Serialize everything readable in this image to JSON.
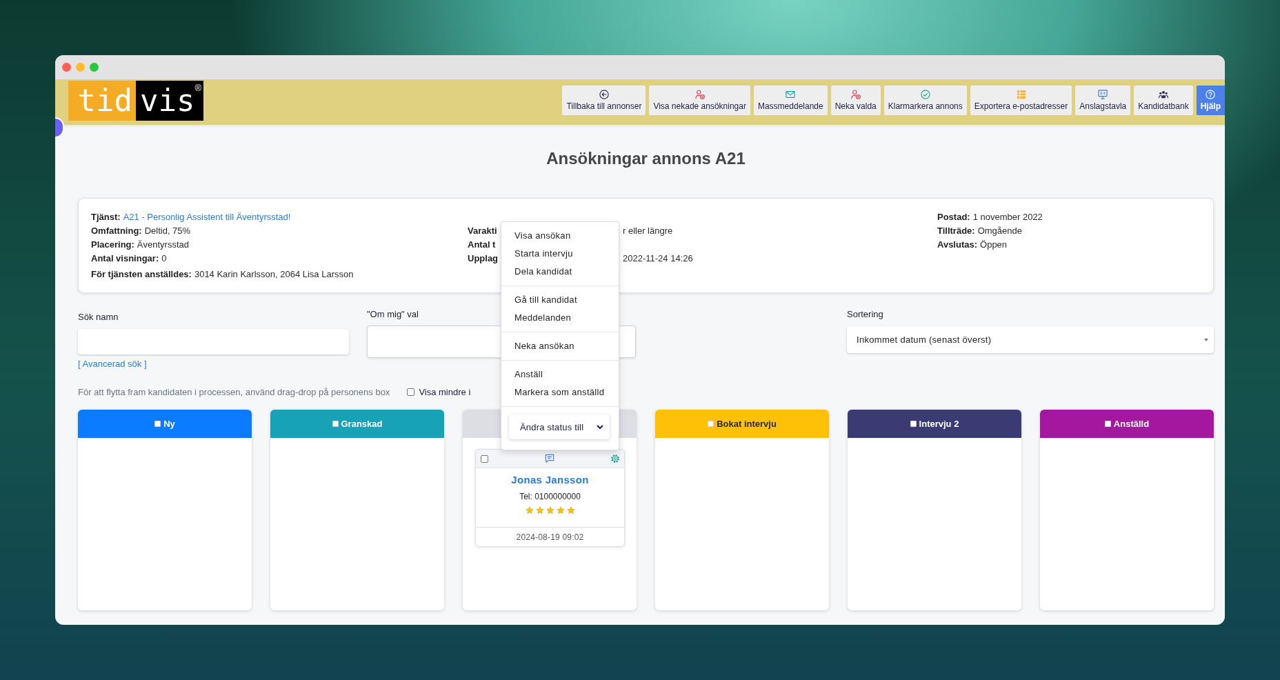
{
  "logo": {
    "left": "tid",
    "right": "vis",
    "mark": "®"
  },
  "toolbar": [
    {
      "label": "Tillbaka till annonser",
      "kind": "default"
    },
    {
      "label": "Visa nekade ansökningar",
      "kind": "default"
    },
    {
      "label": "Massmeddelande",
      "kind": "default"
    },
    {
      "label": "Neka valda",
      "kind": "default"
    },
    {
      "label": "Klarmarkera annons",
      "kind": "default"
    },
    {
      "label": "Exportera e-postadresser",
      "kind": "default"
    },
    {
      "label": "Anslagstavla",
      "kind": "default"
    },
    {
      "label": "Kandidatbank",
      "kind": "default"
    },
    {
      "label": "Hjälp",
      "kind": "primary"
    }
  ],
  "page_title": "Ansökningar annons A21",
  "info": {
    "service": {
      "label": "Tjänst:",
      "link": "A21 - Personlig Assistent till Äventyrsstad!"
    },
    "left": [
      {
        "label": "Omfattning:",
        "value": "Deltid, 75%"
      },
      {
        "label": "Placering:",
        "value": "Äventyrsstad"
      },
      {
        "label": "Antal visningar:",
        "value": "0"
      }
    ],
    "hired": {
      "label": "För tjänsten anställdes:",
      "value": "3014 Karin Karlsson, 2064 Lisa Larsson"
    },
    "middle": [
      {
        "label": "Varakti",
        "value": "r eller längre"
      },
      {
        "label": "Antal t"
      },
      {
        "label": "Upplag",
        "value": "2022-11-24 14:26"
      }
    ],
    "right": [
      {
        "label": "Postad:",
        "value": "1 november 2022"
      },
      {
        "label": "Tillträde:",
        "value": "Omgående"
      },
      {
        "label": "Avslutas:",
        "value": "Öppen"
      }
    ]
  },
  "filters": {
    "name_search": {
      "label": "Sök namn"
    },
    "advanced_search": "[ Avancerad sök ]",
    "about_me": {
      "label": "\"Om mig\" val"
    },
    "sorting": {
      "label": "Sortering",
      "value": "Inkommet datum (senast överst)"
    }
  },
  "hint": "För att flytta fram kandidaten i processen, använd drag-drop på personens box",
  "compact_view": {
    "label": "Visa mindre i",
    "checked": false
  },
  "columns": [
    {
      "title": "Ny",
      "color": "#0b7bff",
      "checked": false
    },
    {
      "title": "Granskad",
      "color": "#17a2b8",
      "checked": false
    },
    {
      "color": "#dcdee4",
      "cards": [
        {
          "name": "Jonas Jansson",
          "phone": "Tel: 0100000000",
          "stars": 5,
          "date": "2024-08-19 09:02",
          "checked": false
        }
      ]
    },
    {
      "title": "Bokat intervju",
      "color": "#ffc107",
      "checked": false
    },
    {
      "title": "Intervju 2",
      "color": "#3b3b73",
      "checked": false
    },
    {
      "title": "Anställd",
      "color": "#a4179f",
      "checked": false
    }
  ],
  "context_menu": {
    "groups": [
      [
        "Visa ansökan",
        "Starta intervju",
        "Dela kandidat"
      ],
      [
        "Gå till kandidat",
        "Meddelanden"
      ],
      [
        "Neka ansökan"
      ],
      [
        "Anställ",
        "Markera som anställd"
      ]
    ],
    "status_select": "Ändra status till"
  }
}
